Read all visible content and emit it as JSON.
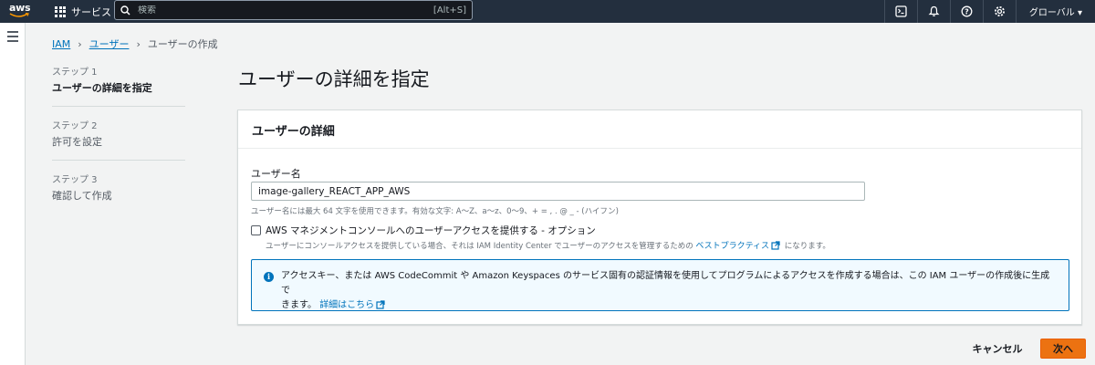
{
  "topnav": {
    "logo_text": "aws",
    "services_label": "サービス",
    "search_placeholder": "検索",
    "search_shortcut": "[Alt+S]",
    "region_label": "グローバル ▾",
    "icons": [
      "cloudshell-icon",
      "bell-icon",
      "help-icon",
      "gear-icon"
    ]
  },
  "breadcrumb": {
    "items": [
      "IAM",
      "ユーザー",
      "ユーザーの作成"
    ]
  },
  "steps": [
    {
      "label": "ステップ 1",
      "title": "ユーザーの詳細を指定"
    },
    {
      "label": "ステップ 2",
      "title": "許可を設定"
    },
    {
      "label": "ステップ 3",
      "title": "確認して作成"
    }
  ],
  "page_title": "ユーザーの詳細を指定",
  "panel": {
    "header": "ユーザーの詳細",
    "username_label": "ユーザー名",
    "username_value": "image-gallery_REACT_APP_AWS",
    "username_constraint": "ユーザー名には最大 64 文字を使用できます。有効な文字: A～Z、a～z、0～9、+ = , . @ _ - (ハイフン)",
    "console_access_label": "AWS マネジメントコンソールへのユーザーアクセスを提供する - オプション",
    "console_access_desc_pre": "ユーザーにコンソールアクセスを提供している場合、それは IAM Identity Center でユーザーのアクセスを管理するための",
    "console_access_link": "ベストプラクティス",
    "console_access_desc_post": "になります。",
    "info_text_1": "アクセスキー、または AWS CodeCommit や Amazon Keyspaces のサービス固有の認証情報を使用してプログラムによるアクセスを作成する場合は、この IAM ユーザーの作成後に生成で",
    "info_text_2": "きます。",
    "info_link": "詳細はこちら"
  },
  "footer": {
    "cancel_label": "キャンセル",
    "next_label": "次へ"
  },
  "colors": {
    "nav_bg": "#232f3e",
    "link": "#0073bb",
    "primary_button": "#ec7211",
    "info_bg": "#f1faff"
  }
}
